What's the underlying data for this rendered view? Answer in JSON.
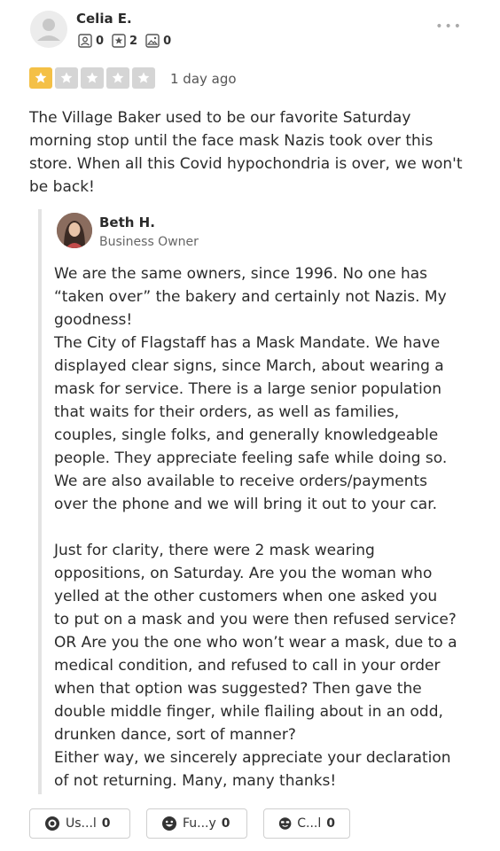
{
  "reviewer": {
    "name": "Celia E.",
    "stats": {
      "friends": "0",
      "reviews": "2",
      "photos": "0"
    },
    "rating": 1,
    "max_rating": 5,
    "date": "1 day ago",
    "review_text": "The Village Baker used to be our favorite Saturday morning stop until the face mask Nazis took over this store. When all this Covid hypochondria is over, we won't be back!"
  },
  "more_icon": "ellipsis-icon",
  "owner_reply": {
    "name": "Beth H.",
    "role": "Business Owner",
    "paragraph1_lines": [
      "We are the same owners, since 1996. No one has",
      "“taken over” the bakery and certainly not Nazis. My",
      "goodness!",
      "The City of Flagstaff has a Mask Mandate. We have",
      "displayed clear signs, since March, about wearing a",
      "mask for service. There is a large senior population",
      "that waits for their orders, as well as families,",
      "couples, single folks, and generally knowledgeable",
      "people. They appreciate feeling safe while doing so.",
      "We are also available to receive orders/payments",
      "over the phone and we will bring it out to your car."
    ],
    "paragraph2_lines": [
      "Just for clarity, there were 2 mask wearing",
      "oppositions, on Saturday. Are you the woman who",
      "yelled at the other customers when one asked you",
      "to put on a mask and you were then refused service?",
      "OR Are you the one who won’t wear a mask, due to a",
      "medical condition, and refused to call in your order",
      "when that option was suggested? Then gave the",
      "double middle finger, while flailing about in an odd,",
      "drunken dance, sort of manner?",
      "Either way, we sincerely appreciate your declaration",
      "of not returning. Many, many thanks!"
    ]
  },
  "reactions": [
    {
      "label": "Us...l",
      "count": "0",
      "icon": "useful-icon"
    },
    {
      "label": "Fu...y",
      "count": "0",
      "icon": "funny-icon"
    },
    {
      "label": "C...l",
      "count": "0",
      "icon": "cool-icon"
    }
  ],
  "colors": {
    "star_on": "#f4c046",
    "star_off": "#d5d5d5"
  }
}
